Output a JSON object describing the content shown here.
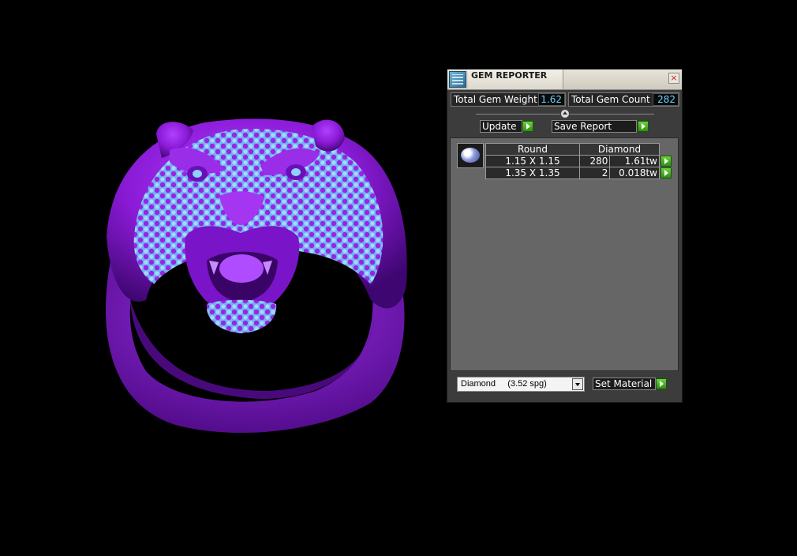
{
  "viewport": {
    "model_colors": {
      "metal": "#8a1ad6",
      "metal_dark": "#4a0880",
      "gem": "#7ec0ff"
    }
  },
  "panel": {
    "title": "GEM REPORTER",
    "close_glyph": "×",
    "total_weight_label": "Total Gem Weight",
    "total_weight_value": "1.62",
    "total_count_label": "Total Gem Count",
    "total_count_value": "282",
    "update_label": "Update",
    "save_report_label": "Save Report",
    "table": {
      "headers": [
        "Round",
        "Diamond"
      ],
      "rows": [
        {
          "size": "1.15 X 1.15",
          "count": "280",
          "weight": "1.61tw"
        },
        {
          "size": "1.35 X 1.35",
          "count": "2",
          "weight": "0.018tw"
        }
      ]
    },
    "material_select_value": "Diamond     (3.52 spg)",
    "set_material_label": "Set Material"
  }
}
